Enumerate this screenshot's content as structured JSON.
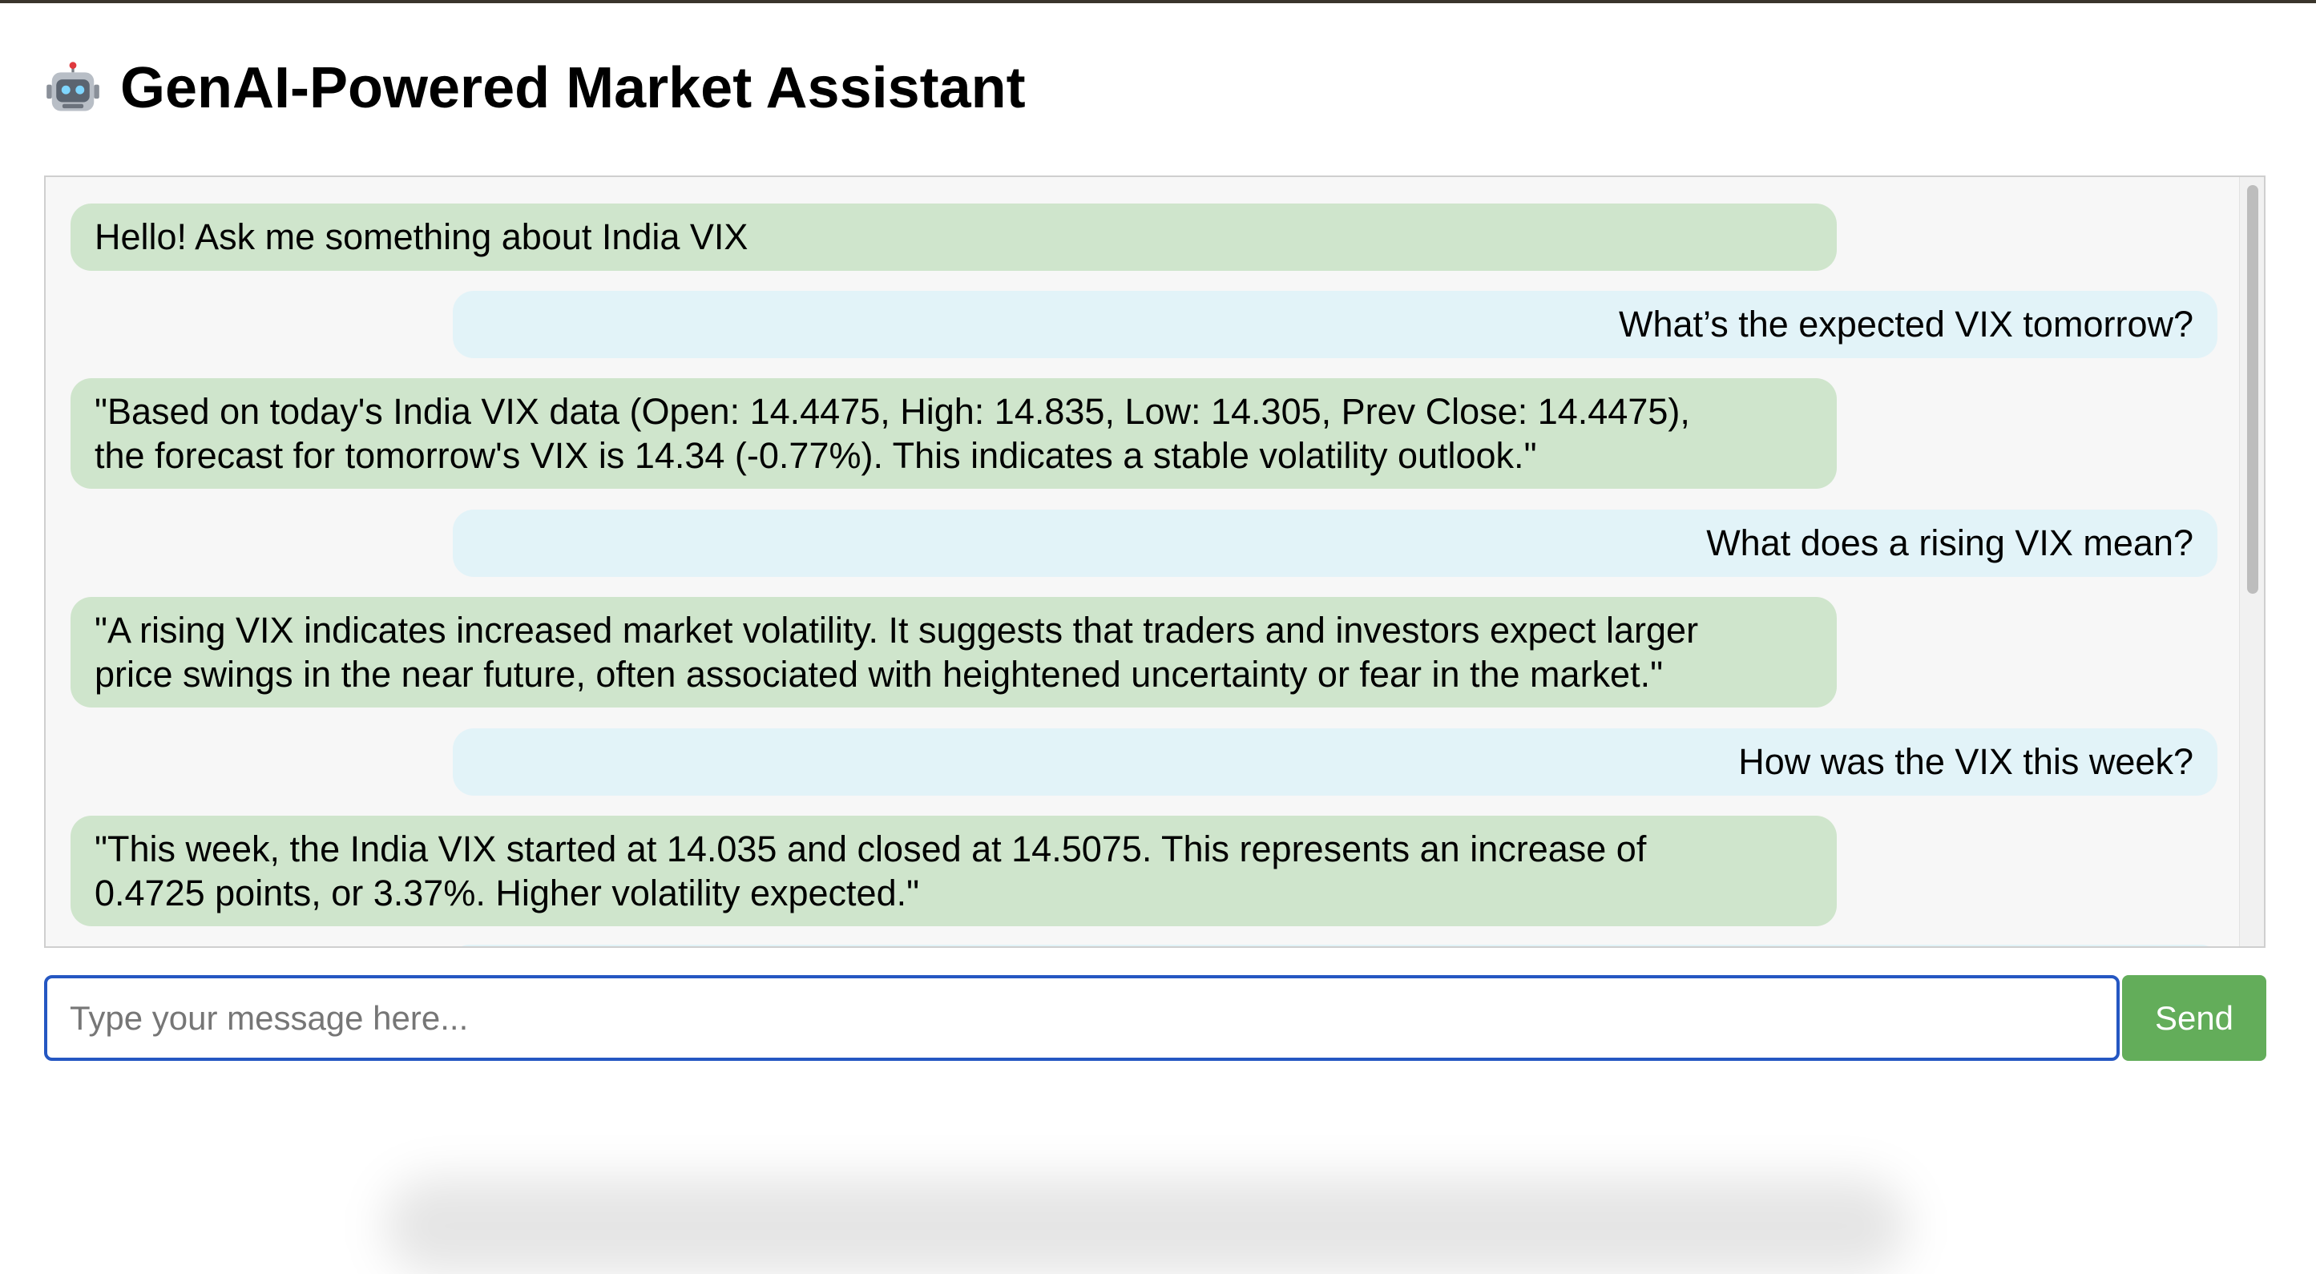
{
  "app": {
    "title": "GenAI-Powered Market Assistant",
    "title_icon": "robot-icon"
  },
  "chat": {
    "messages": [
      {
        "role": "bot",
        "text": "Hello! Ask me something about India VIX",
        "lines": [
          "Hello! Ask me something about India VIX"
        ]
      },
      {
        "role": "user",
        "text": "What’s the expected VIX tomorrow?",
        "lines": [
          "What’s the expected VIX tomorrow?"
        ]
      },
      {
        "role": "bot",
        "text": "\"Based on today's India VIX data (Open: 14.4475, High: 14.835, Low: 14.305, Prev Close: 14.4475), the forecast for tomorrow's VIX is 14.34 (-0.77%). This indicates a stable volatility outlook.\"",
        "lines": [
          "\"Based on today's India VIX data (Open: 14.4475, High: 14.835, Low: 14.305, Prev Close: 14.4475),",
          "the forecast for tomorrow's VIX is 14.34 (-0.77%). This indicates a stable volatility outlook.\""
        ]
      },
      {
        "role": "user",
        "text": "What does a rising VIX mean?",
        "lines": [
          "What does a rising VIX mean?"
        ]
      },
      {
        "role": "bot",
        "text": "\"A rising VIX indicates increased market volatility. It suggests that traders and investors expect larger price swings in the near future, often associated with heightened uncertainty or fear in the market.\"",
        "lines": [
          "\"A rising VIX indicates increased market volatility. It suggests that traders and investors expect larger",
          "price swings in the near future, often associated with heightened uncertainty or fear in the market.\""
        ]
      },
      {
        "role": "user",
        "text": "How was the VIX this week?",
        "lines": [
          "How was the VIX this week?"
        ]
      },
      {
        "role": "bot",
        "text": "\"This week, the India VIX started at 14.035 and closed at 14.5075. This represents an increase of 0.4725 points, or 3.37%. Higher volatility expected.\"",
        "lines": [
          "\"This week, the India VIX started at 14.035 and closed at 14.5075. This represents an increase of",
          "0.4725 points, or 3.37%. Higher volatility expected.\""
        ]
      }
    ]
  },
  "input": {
    "placeholder": "Type your message here...",
    "value": ""
  },
  "send_button": {
    "label": "Send"
  },
  "colors": {
    "bot_bubble": "#cfe5cc",
    "user_bubble": "#e2f3f8",
    "send_button": "#63ad5a",
    "input_focus_border": "#2557c2"
  }
}
